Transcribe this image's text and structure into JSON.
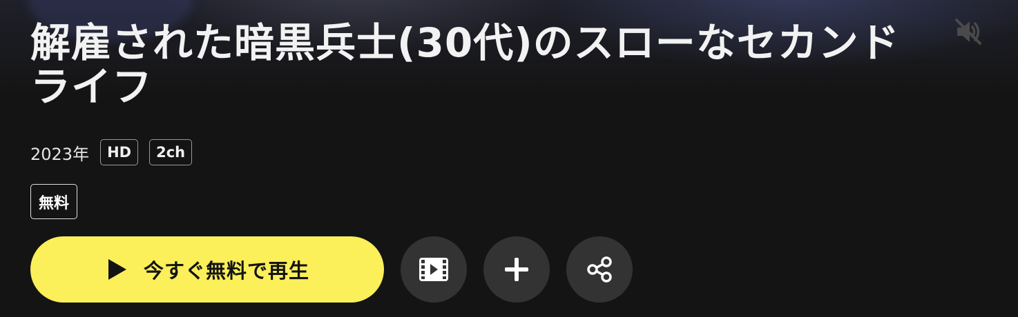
{
  "show": {
    "title": "解雇された暗黒兵士(30代)のスローなセカンドライフ",
    "year": "2023年",
    "quality_badges": [
      "HD",
      "2ch"
    ],
    "price_badge": "無料"
  },
  "actions": {
    "play_label": "今すぐ無料で再生",
    "trailer_icon": "film-icon",
    "add_icon": "plus-icon",
    "share_icon": "share-icon",
    "mute_icon": "speaker-muted-icon"
  },
  "colors": {
    "accent": "#fbef5a",
    "background": "#141414",
    "round_button": "#333333"
  }
}
